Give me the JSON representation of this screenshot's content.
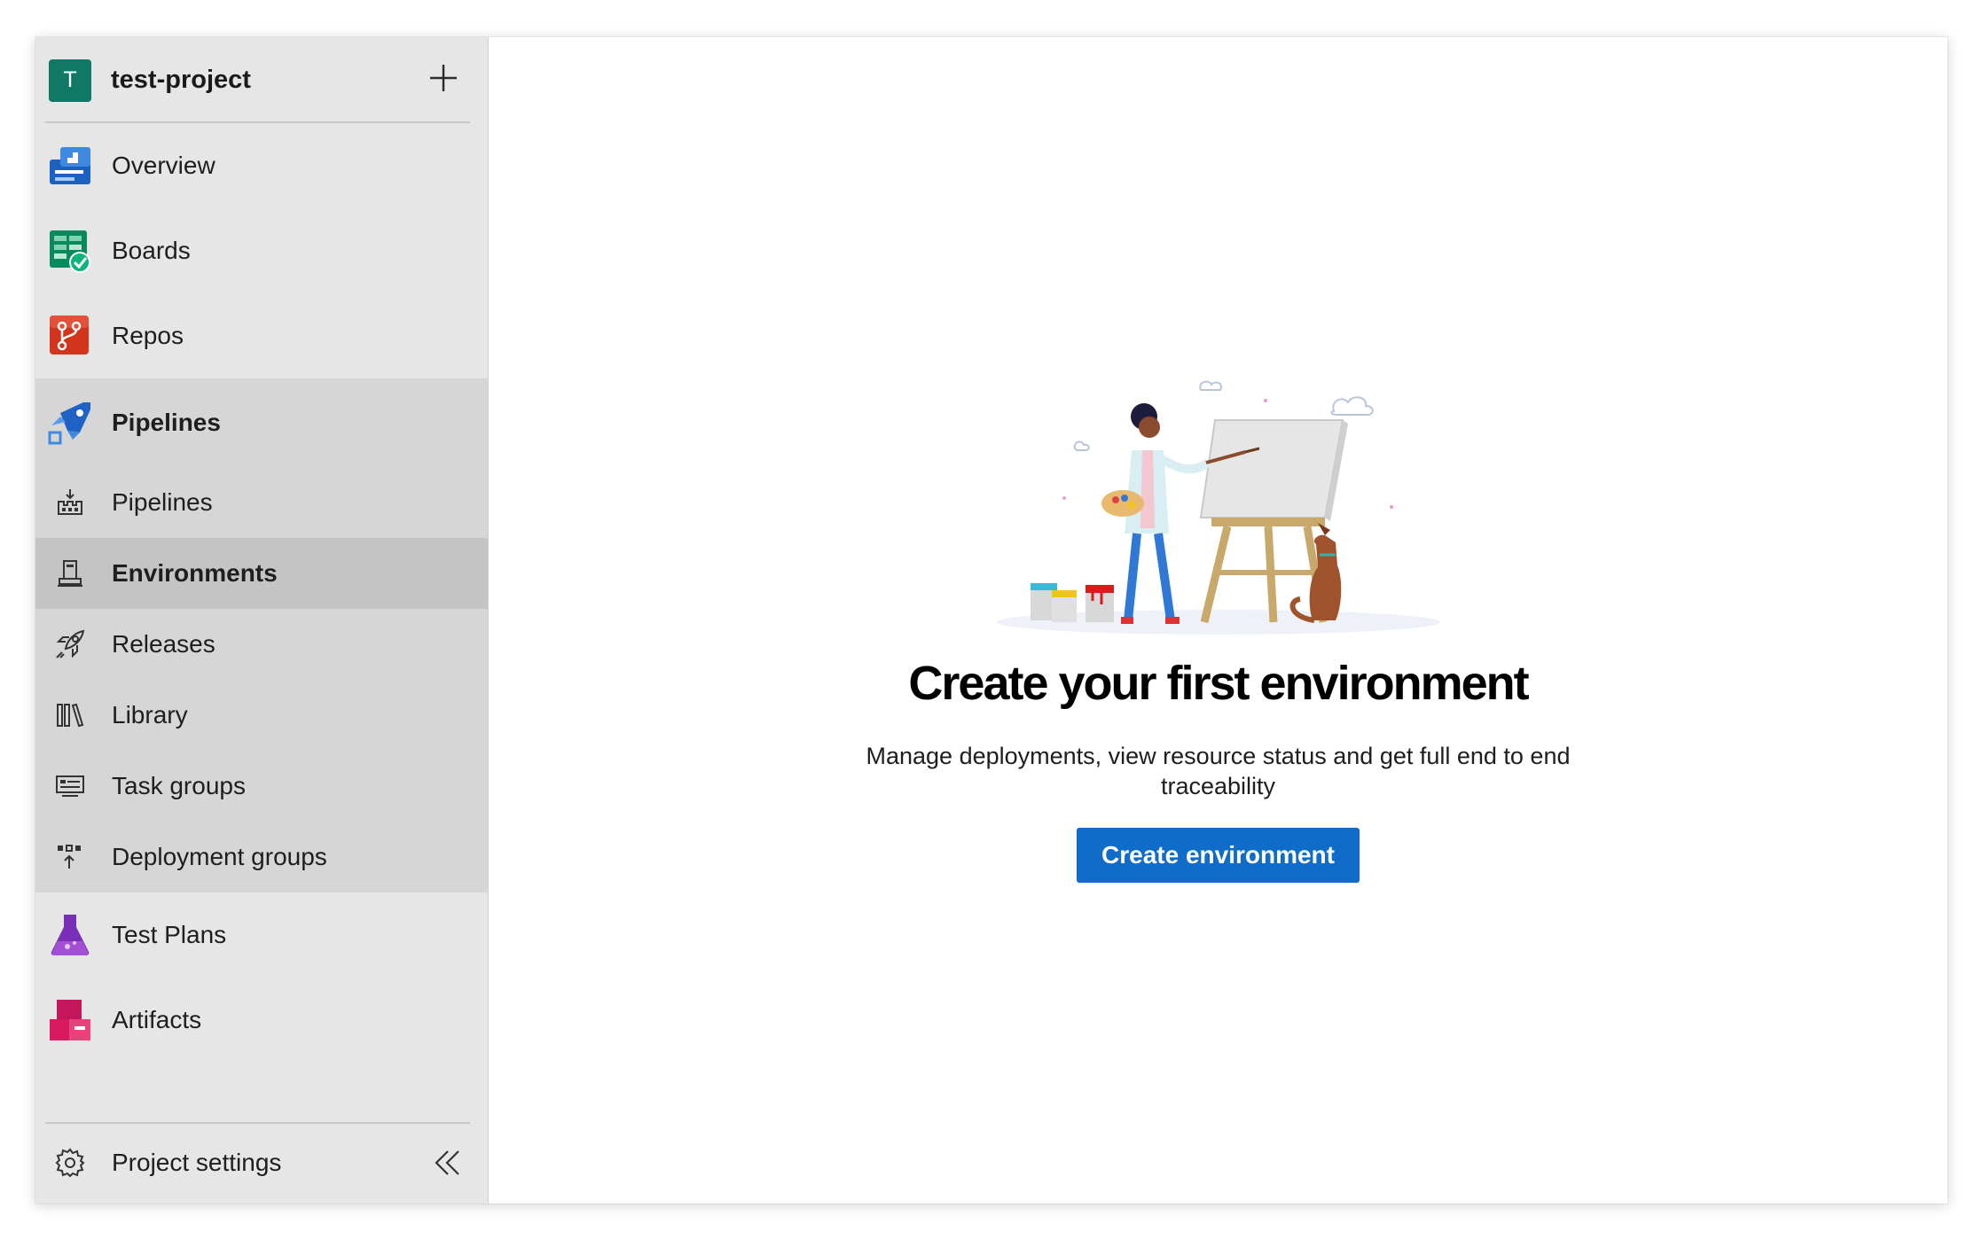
{
  "project": {
    "initial": "T",
    "name": "test-project",
    "avatar_color": "#117865"
  },
  "nav": {
    "items": [
      {
        "label": "Overview",
        "icon": "overview-icon"
      },
      {
        "label": "Boards",
        "icon": "boards-icon"
      },
      {
        "label": "Repos",
        "icon": "repos-icon"
      }
    ],
    "pipelines_group": {
      "label": "Pipelines",
      "icon": "pipelines-icon",
      "sub_items": [
        {
          "label": "Pipelines",
          "icon": "pipelines-sub-icon"
        },
        {
          "label": "Environments",
          "icon": "environments-icon",
          "selected": true
        },
        {
          "label": "Releases",
          "icon": "rocket-icon"
        },
        {
          "label": "Library",
          "icon": "library-icon"
        },
        {
          "label": "Task groups",
          "icon": "task-groups-icon"
        },
        {
          "label": "Deployment groups",
          "icon": "deployment-groups-icon"
        }
      ]
    },
    "after_items": [
      {
        "label": "Test Plans",
        "icon": "test-plans-icon"
      },
      {
        "label": "Artifacts",
        "icon": "artifacts-icon"
      }
    ],
    "footer": {
      "label": "Project settings",
      "icon": "gear-icon"
    }
  },
  "empty_state": {
    "title": "Create your first environment",
    "description": "Manage deployments, view resource status and get full end to end traceability",
    "button_label": "Create environment"
  },
  "colors": {
    "accent": "#0f6cc8",
    "sidebar_bg": "#e6e6e6",
    "group_bg": "#d6d6d6",
    "selected_bg": "#c4c4c4"
  }
}
